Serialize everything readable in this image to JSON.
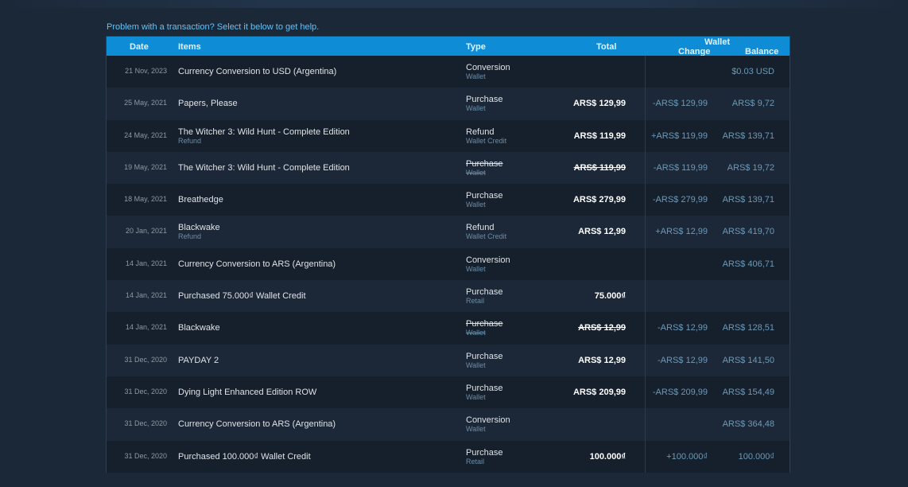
{
  "help_link": "Problem with a transaction? Select it below to get help.",
  "header": {
    "date": "Date",
    "items": "Items",
    "type": "Type",
    "total": "Total",
    "wallet": "Wallet",
    "change": "Change",
    "balance": "Balance"
  },
  "rows": [
    {
      "date": "21 Nov, 2023",
      "item": "Currency Conversion to USD (Argentina)",
      "item_sub": "",
      "type": "Conversion",
      "type_sub": "Wallet",
      "total": "",
      "change": "",
      "balance": "$0.03 USD",
      "struck": false
    },
    {
      "date": "25 May, 2021",
      "item": "Papers, Please",
      "item_sub": "",
      "type": "Purchase",
      "type_sub": "Wallet",
      "total": "ARS$ 129,99",
      "change": "-ARS$ 129,99",
      "balance": "ARS$ 9,72",
      "struck": false
    },
    {
      "date": "24 May, 2021",
      "item": "The Witcher 3: Wild Hunt - Complete Edition",
      "item_sub": "Refund",
      "type": "Refund",
      "type_sub": "Wallet Credit",
      "total": "ARS$ 119,99",
      "change": "+ARS$ 119,99",
      "balance": "ARS$ 139,71",
      "struck": false
    },
    {
      "date": "19 May, 2021",
      "item": "The Witcher 3: Wild Hunt - Complete Edition",
      "item_sub": "",
      "type": "Purchase",
      "type_sub": "Wallet",
      "total": "ARS$ 119,99",
      "change": "-ARS$ 119,99",
      "balance": "ARS$ 19,72",
      "struck": true
    },
    {
      "date": "18 May, 2021",
      "item": "Breathedge",
      "item_sub": "",
      "type": "Purchase",
      "type_sub": "Wallet",
      "total": "ARS$ 279,99",
      "change": "-ARS$ 279,99",
      "balance": "ARS$ 139,71",
      "struck": false
    },
    {
      "date": "20 Jan, 2021",
      "item": "Blackwake",
      "item_sub": "Refund",
      "type": "Refund",
      "type_sub": "Wallet Credit",
      "total": "ARS$ 12,99",
      "change": "+ARS$ 12,99",
      "balance": "ARS$ 419,70",
      "struck": false
    },
    {
      "date": "14 Jan, 2021",
      "item": "Currency Conversion to ARS (Argentina)",
      "item_sub": "",
      "type": "Conversion",
      "type_sub": "Wallet",
      "total": "",
      "change": "",
      "balance": "ARS$ 406,71",
      "struck": false
    },
    {
      "date": "14 Jan, 2021",
      "item": "Purchased 75.000₫ Wallet Credit",
      "item_sub": "",
      "type": "Purchase",
      "type_sub": "Retail",
      "total": "75.000₫",
      "change": "",
      "balance": "",
      "struck": false
    },
    {
      "date": "14 Jan, 2021",
      "item": "Blackwake",
      "item_sub": "",
      "type": "Purchase",
      "type_sub": "Wallet",
      "total": "ARS$ 12,99",
      "change": "-ARS$ 12,99",
      "balance": "ARS$ 128,51",
      "struck": true
    },
    {
      "date": "31 Dec, 2020",
      "item": "PAYDAY 2",
      "item_sub": "",
      "type": "Purchase",
      "type_sub": "Wallet",
      "total": "ARS$ 12,99",
      "change": "-ARS$ 12,99",
      "balance": "ARS$ 141,50",
      "struck": false
    },
    {
      "date": "31 Dec, 2020",
      "item": "Dying Light Enhanced Edition ROW",
      "item_sub": "",
      "type": "Purchase",
      "type_sub": "Wallet",
      "total": "ARS$ 209,99",
      "change": "-ARS$ 209,99",
      "balance": "ARS$ 154,49",
      "struck": false
    },
    {
      "date": "31 Dec, 2020",
      "item": "Currency Conversion to ARS (Argentina)",
      "item_sub": "",
      "type": "Conversion",
      "type_sub": "Wallet",
      "total": "",
      "change": "",
      "balance": "ARS$ 364,48",
      "struck": false
    },
    {
      "date": "31 Dec, 2020",
      "item": "Purchased 100.000₫ Wallet Credit",
      "item_sub": "",
      "type": "Purchase",
      "type_sub": "Retail",
      "total": "100.000₫",
      "change": "+100.000₫",
      "balance": "100.000₫",
      "struck": false
    }
  ]
}
